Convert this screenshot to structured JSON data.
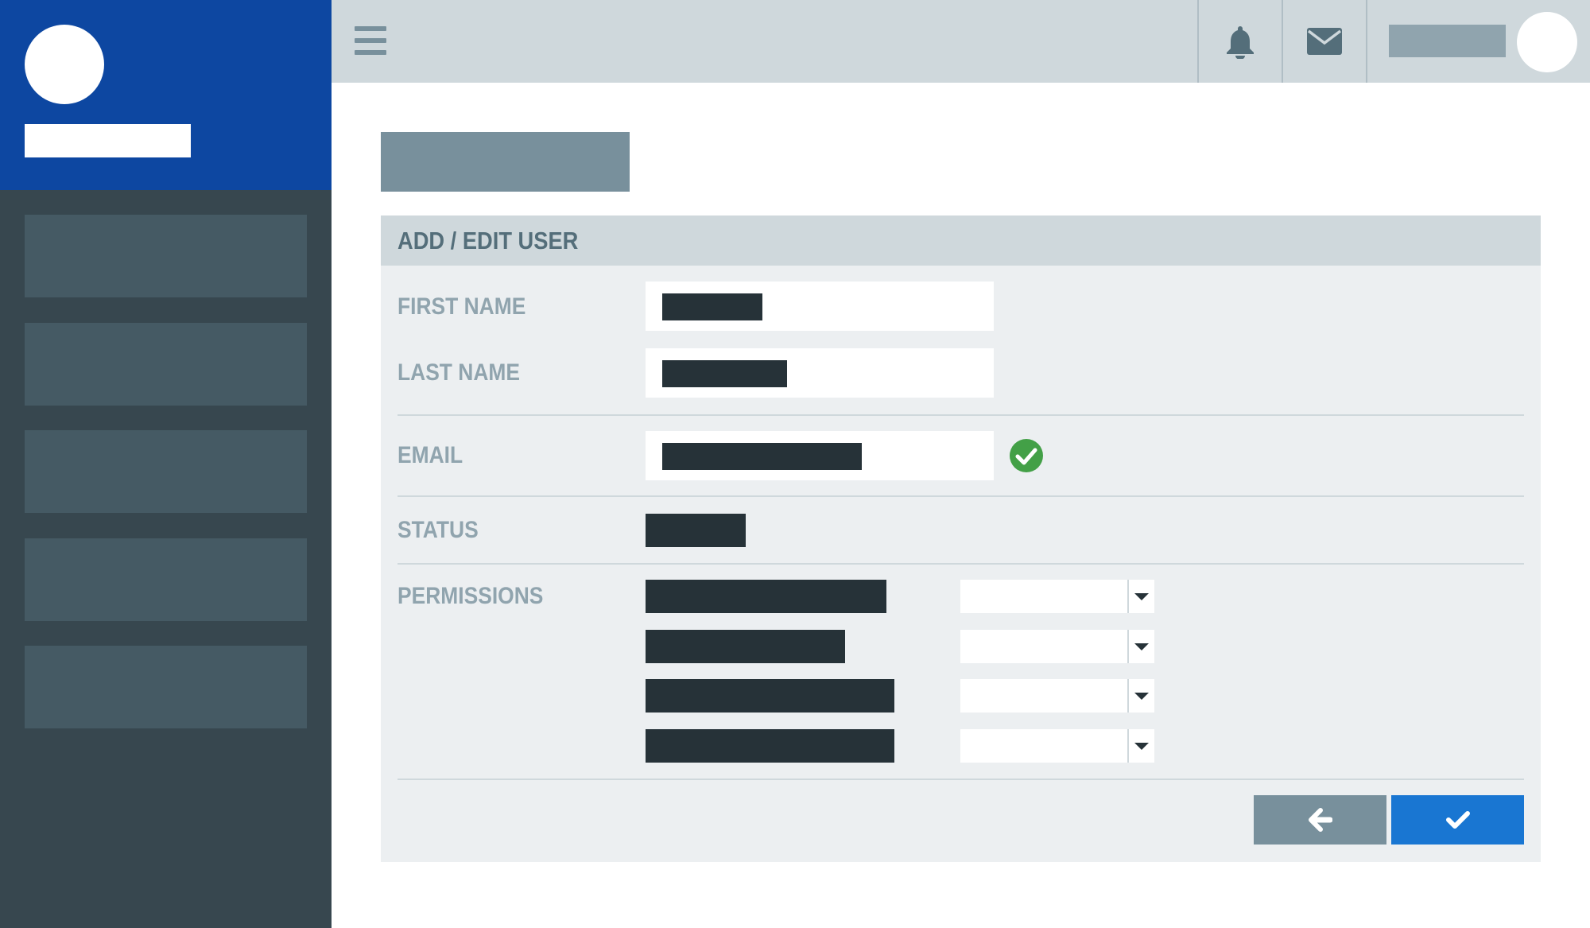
{
  "panel": {
    "title": "ADD / EDIT USER",
    "labels": {
      "first_name": "FIRST NAME",
      "last_name": "LAST NAME",
      "email": "EMAIL",
      "status": "STATUS",
      "permissions": "PERMISSIONS"
    }
  },
  "icons": {
    "menu": "menu-icon",
    "notifications": "bell-icon",
    "messages": "envelope-icon",
    "email_valid": "check-circle-icon",
    "back": "arrow-left-icon",
    "confirm": "check-icon",
    "dropdown": "caret-down-icon"
  },
  "colors": {
    "brand": "#0d47a1",
    "sidebar": "#37474f",
    "topbar": "#cfd8dc",
    "panel": "#eceff1",
    "valid": "#43a047",
    "confirm": "#1976d2",
    "back": "#78909c"
  }
}
